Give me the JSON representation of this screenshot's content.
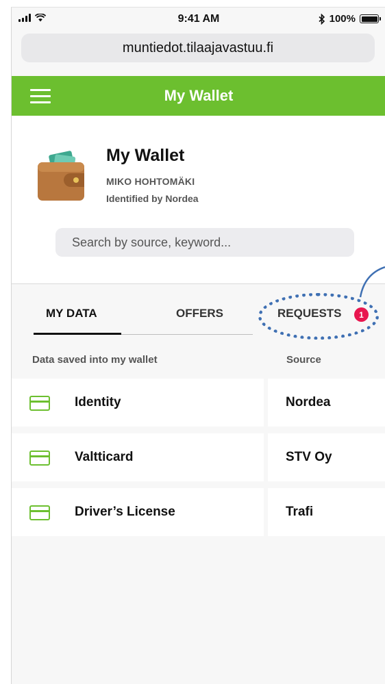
{
  "status_bar": {
    "time": "9:41 AM",
    "battery": "100%",
    "battery_level": 1.0
  },
  "browser": {
    "url": "muntiedot.tilaajavastuu.fi"
  },
  "header": {
    "title": "My Wallet"
  },
  "profile": {
    "title": "My Wallet",
    "name": "MIKO HOHTOMÄKI",
    "identified": "Identified by Nordea"
  },
  "search": {
    "placeholder": "Search by source, keyword..."
  },
  "tabs": [
    {
      "label": "MY DATA",
      "active": true
    },
    {
      "label": "OFFERS",
      "active": false
    },
    {
      "label": "REQUESTS",
      "active": false,
      "badge": "1"
    }
  ],
  "list": {
    "header_left": "Data saved into my wallet",
    "header_right": "Source",
    "rows": [
      {
        "label": "Identity",
        "source": "Nordea"
      },
      {
        "label": "Valtticard",
        "source": "STV Oy"
      },
      {
        "label": "Driver’s License",
        "source": "Trafi"
      }
    ]
  },
  "colors": {
    "accent": "#6cbf2f",
    "badge": "#e8164f",
    "highlight": "#3f70b3"
  }
}
